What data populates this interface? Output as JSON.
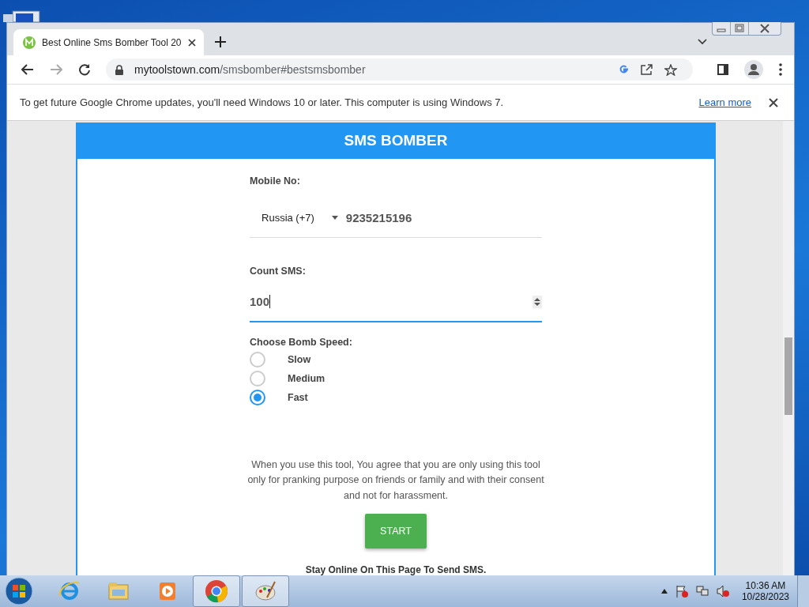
{
  "browser": {
    "tabs": [
      {
        "title": "Best Online Sms Bomber Tool 20",
        "selected": true
      }
    ],
    "url_domain": "mytoolstown.com",
    "url_path": "/smsbomber#bestsmsbomber",
    "infobar": {
      "message": "To get future Google Chrome updates, you'll need Windows 10 or later. This computer is using Windows 7.",
      "link": "Learn more"
    }
  },
  "page": {
    "header": "SMS BOMBER",
    "mobile_label": "Mobile No:",
    "country": "Russia (+7)",
    "phone": "9235215196",
    "count_label": "Count SMS:",
    "count_value": "100",
    "speed_label": "Choose Bomb Speed:",
    "speeds": [
      {
        "label": "Slow",
        "selected": false
      },
      {
        "label": "Medium",
        "selected": false
      },
      {
        "label": "Fast",
        "selected": true
      }
    ],
    "disclaimer": "When you use this tool, You agree that you are only using this tool only for pranking purpose on friends or family and with their consent and not for harassment.",
    "start_button": "START",
    "footer_note": "Stay Online On This Page To Send SMS."
  },
  "taskbar": {
    "apps": [
      {
        "kind": "ie",
        "selected": false
      },
      {
        "kind": "explorer",
        "selected": false
      },
      {
        "kind": "media",
        "selected": false
      },
      {
        "kind": "chrome",
        "selected": true
      },
      {
        "kind": "paint",
        "selected": true
      }
    ],
    "time": "10:36 AM",
    "date": "10/28/2023"
  }
}
